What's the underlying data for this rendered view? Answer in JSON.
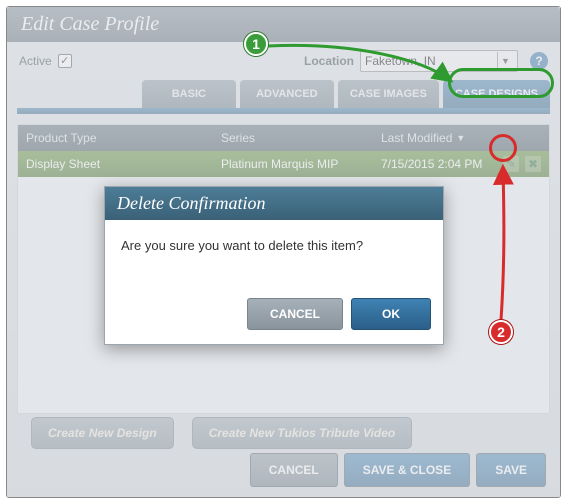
{
  "window": {
    "title": "Edit Case Profile"
  },
  "toprow": {
    "active_label": "Active",
    "active_checked": true,
    "location_label": "Location",
    "location_value": "Faketown, IN",
    "help_glyph": "?"
  },
  "tabs": [
    {
      "label": "BASIC"
    },
    {
      "label": "ADVANCED"
    },
    {
      "label": "CASE IMAGES"
    },
    {
      "label": "CASE DESIGNS",
      "active": true
    }
  ],
  "grid": {
    "columns": {
      "product_type": "Product Type",
      "series": "Series",
      "last_modified": "Last Modified"
    },
    "rows": [
      {
        "product_type": "Display Sheet",
        "series": "Platinum Marquis MIP",
        "last_modified": "7/15/2015 2:04 PM"
      }
    ]
  },
  "bottom_left": {
    "create_design": "Create New Design",
    "create_tukios": "Create New Tukios Tribute Video"
  },
  "bottom_right": {
    "cancel": "CANCEL",
    "save_close": "SAVE & CLOSE",
    "save": "SAVE"
  },
  "modal": {
    "title": "Delete Confirmation",
    "body": "Are you sure you want to delete this item?",
    "cancel": "CANCEL",
    "ok": "OK"
  },
  "annotations": {
    "step1": "1",
    "step2": "2"
  }
}
